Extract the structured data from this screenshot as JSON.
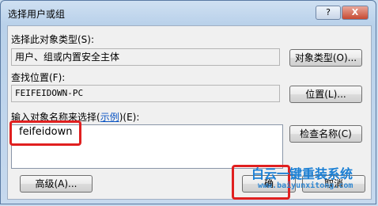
{
  "window": {
    "title": "选择用户或组",
    "help_label": "?",
    "close_label": "X"
  },
  "object_types": {
    "label": "选择此对象类型(S):",
    "value": "用户、组或内置安全主体",
    "button": "对象类型(O)..."
  },
  "location": {
    "label": "查找位置(F):",
    "value": "FEIFEIDOWN-PC",
    "button": "位置(L)..."
  },
  "names": {
    "label_before": "输入对象名称来选择(",
    "label_link": "示例",
    "label_after": ")(E):",
    "value": "feifeidown",
    "check_button": "检查名称(C)"
  },
  "advanced_button": "高级(A)...",
  "ok_button": "确",
  "cancel_button": "取消",
  "watermark": {
    "line1": "白云一键重装系统",
    "line2": "www.baiyunxitong.com"
  },
  "colors": {
    "highlight": "#e02020",
    "link": "#0b55c4",
    "watermark_blue": "#1a7fd4"
  }
}
